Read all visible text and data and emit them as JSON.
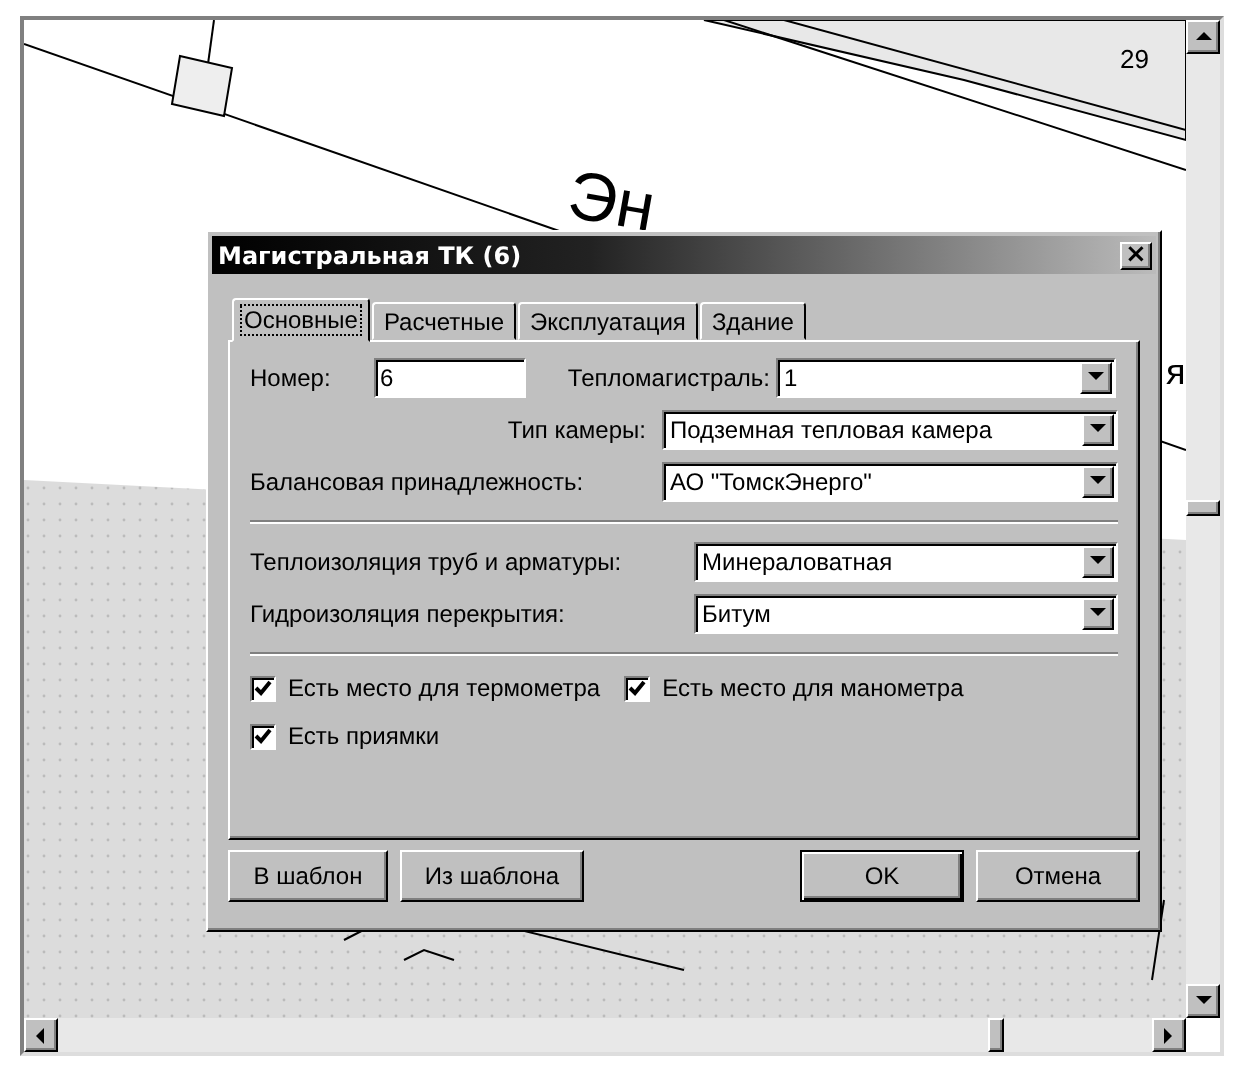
{
  "map": {
    "labels": [
      {
        "kind": "number",
        "text": "29"
      },
      {
        "kind": "street",
        "text": "Эн"
      },
      {
        "kind": "street",
        "text": "я"
      }
    ]
  },
  "dialog": {
    "title": "Магистральная ТК (6)",
    "close": "×",
    "tabs": [
      {
        "label": "Основные",
        "selected": true
      },
      {
        "label": "Расчетные",
        "selected": false
      },
      {
        "label": "Эксплуатация",
        "selected": false
      },
      {
        "label": "Здание",
        "selected": false
      }
    ],
    "number": {
      "label": "Номер:",
      "value": "6"
    },
    "main_line": {
      "label": "Тепломагистраль:",
      "value": "1"
    },
    "chamber_type": {
      "label": "Тип камеры:",
      "value": "Подземная тепловая камера"
    },
    "ownership": {
      "label": "Балансовая принадлежность:",
      "value": "АО \"ТомскЭнерго\""
    },
    "insulation": {
      "label": "Теплоизоляция труб и арматуры:",
      "value": "Минераловатная"
    },
    "waterproofing": {
      "label": "Гидроизоляция перекрытия:",
      "value": "Битум"
    },
    "checkboxes": [
      {
        "label": "Есть место для термометра",
        "checked": true
      },
      {
        "label": "Есть место для манометра",
        "checked": true
      },
      {
        "label": "Есть приямки",
        "checked": true
      }
    ],
    "buttons": [
      {
        "label": "В шаблон",
        "default": false
      },
      {
        "label": "Из шаблона",
        "default": false
      },
      {
        "label": "OK",
        "default": true
      },
      {
        "label": "Отмена",
        "default": false
      }
    ]
  }
}
